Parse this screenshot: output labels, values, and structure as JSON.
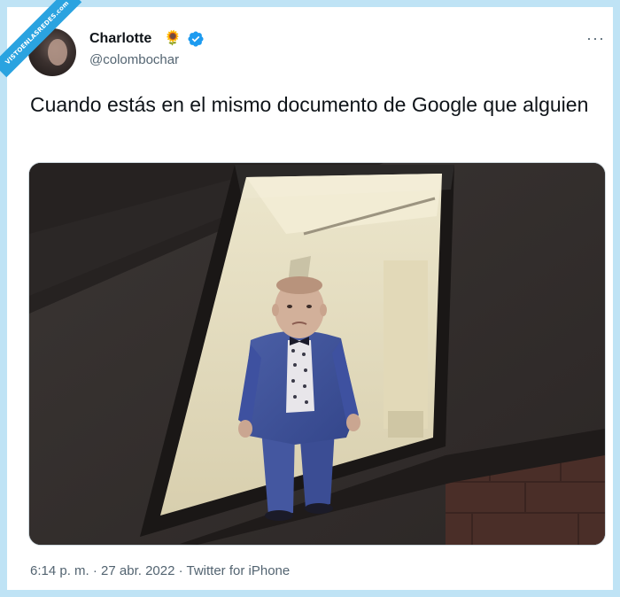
{
  "watermark": {
    "text": "VISTOENLASREDES.com"
  },
  "author": {
    "name": "Charlotte",
    "emoji": "🌻",
    "verified": true,
    "handle": "@colombochar",
    "avatar_icon": "avatar-photo"
  },
  "menu": {
    "more_label": "···"
  },
  "tweet": {
    "text": "Cuando estás en el mismo documento de Google que alguien",
    "media_icon": "photo-child-in-window"
  },
  "meta": {
    "text": "6:14 p. m. · 27 abr. 2022 · Twitter for iPhone"
  },
  "colors": {
    "border": "#bfe3f5",
    "verified": "#1d9bf0",
    "text_primary": "#0f1419",
    "text_secondary": "#536471",
    "watermark_bg": "#2aa3e0"
  }
}
